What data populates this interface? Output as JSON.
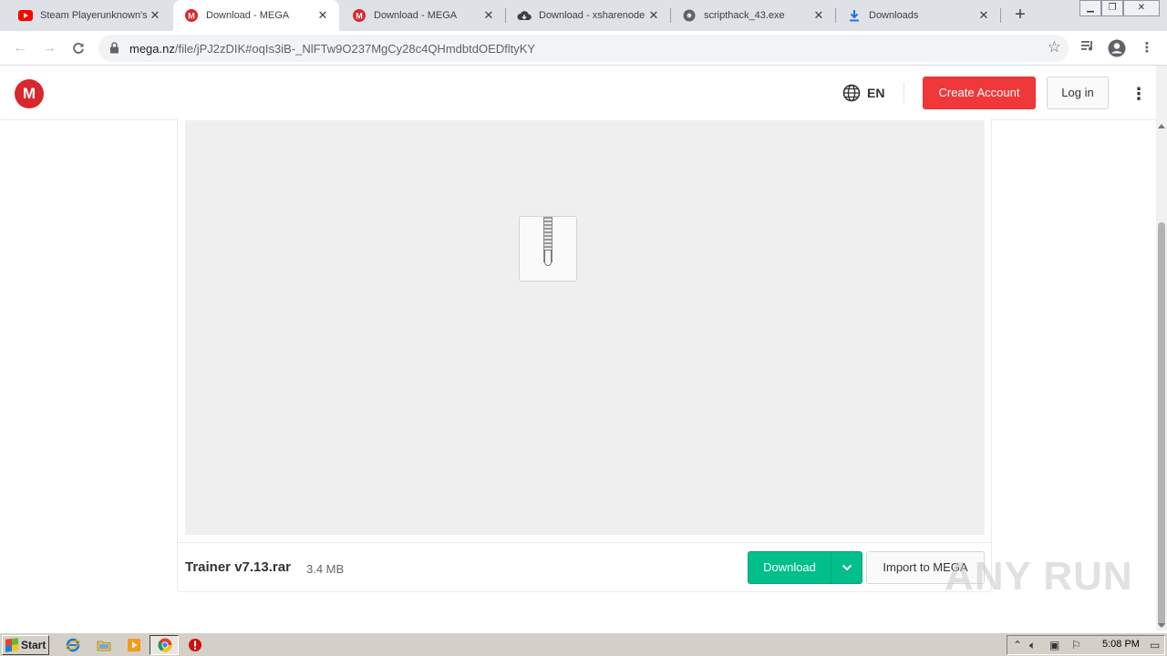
{
  "browser": {
    "tabs": [
      {
        "title": "Steam Playerunknown's B",
        "favicon": "youtube-icon",
        "active": false
      },
      {
        "title": "Download - MEGA",
        "favicon": "mega-icon",
        "active": true
      },
      {
        "title": "Download - MEGA",
        "favicon": "mega-icon",
        "active": false
      },
      {
        "title": "Download - xsharenode",
        "favicon": "cloud-download-icon",
        "active": false
      },
      {
        "title": "scripthack_43.exe",
        "favicon": "globe-icon",
        "active": false
      },
      {
        "title": "Downloads",
        "favicon": "download-icon",
        "active": false
      }
    ],
    "new_tab": "+",
    "url_host": "mega.nz",
    "url_path": "/file/jPJ2zDIK#oqIs3iB-_NlFTw9O237MgCy28c4QHmdbtdOEDfltyKY"
  },
  "mega": {
    "lang": "EN",
    "create_account": "Create Account",
    "login": "Log in"
  },
  "file": {
    "name": "Trainer v7.13.rar",
    "size": "3.4 MB",
    "download_label": "Download",
    "import_label": "Import to MEGA"
  },
  "watermark": "ANY RUN",
  "taskbar": {
    "start_label": "Start",
    "clock": "5:08 PM"
  },
  "colors": {
    "mega_red": "#d9272e",
    "create_account_bg": "#f0373a",
    "download_green": "#00bf8b"
  }
}
